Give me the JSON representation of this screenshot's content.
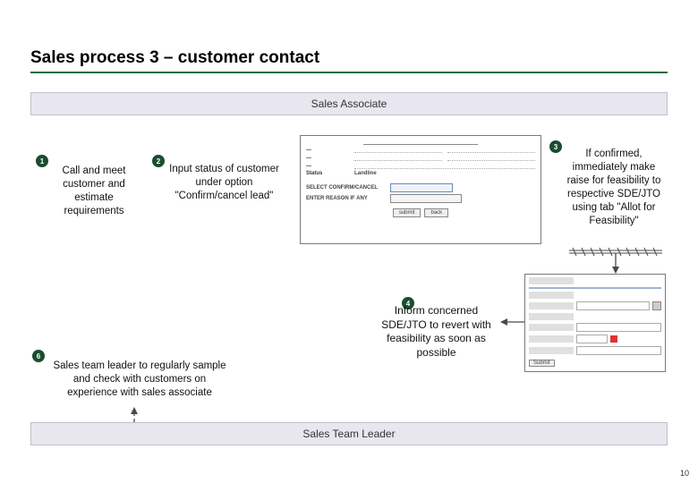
{
  "title": "Sales process 3 – customer contact",
  "roles": {
    "top": "Sales Associate",
    "bottom": "Sales Team Leader"
  },
  "steps": {
    "s1": {
      "num": "1",
      "text": "Call and meet customer and estimate requirements"
    },
    "s2": {
      "num": "2",
      "text": "Input status of customer under option \"Confirm/cancel lead\""
    },
    "s3": {
      "num": "3",
      "text": "If confirmed, immediately make raise for feasibility to respective SDE/JTO using tab \"Allot for Feasibility\""
    },
    "s4": {
      "num": "4",
      "text": "Inform concerned SDE/JTO to revert with feasibility as soon as possible"
    },
    "s6": {
      "num": "6",
      "text": "Sales team leader to regularly sample and check with customers on experience with sales associate"
    }
  },
  "form1": {
    "labels": [
      "Status",
      "SELECT CONFIRM/CANCEL",
      "ENTER REASON IF ANY"
    ],
    "status_val": "Landline",
    "buttons": [
      "submit",
      "back"
    ]
  },
  "form2": {
    "button": "Submit"
  },
  "page_number": "10"
}
